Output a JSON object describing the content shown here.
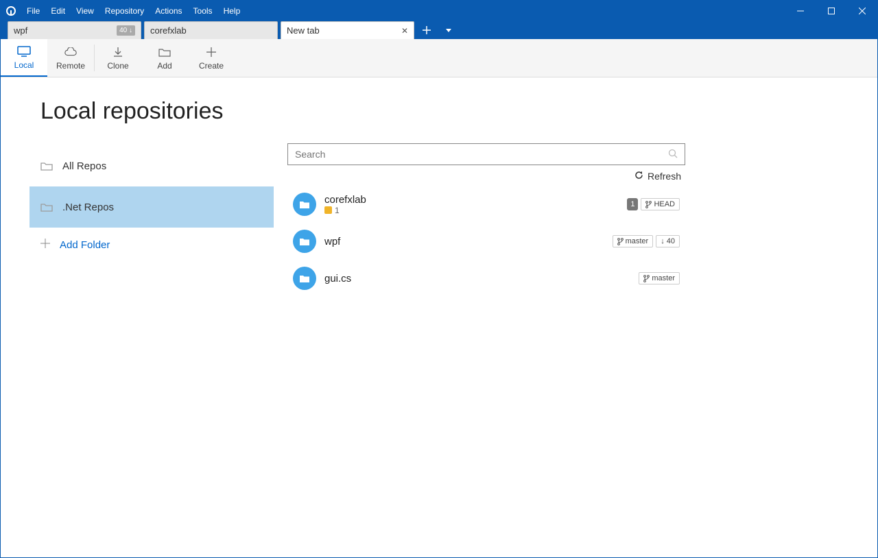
{
  "menu": {
    "file": "File",
    "edit": "Edit",
    "view": "View",
    "repository": "Repository",
    "actions": "Actions",
    "tools": "Tools",
    "help": "Help"
  },
  "tabs": {
    "items": [
      {
        "label": "wpf",
        "badge": "40 ↓"
      },
      {
        "label": "corefxlab"
      },
      {
        "label": "New tab",
        "closable": true,
        "active": true
      }
    ]
  },
  "toolbar": {
    "local": "Local",
    "remote": "Remote",
    "clone": "Clone",
    "add": "Add",
    "create": "Create"
  },
  "page": {
    "title": "Local repositories",
    "folders": [
      {
        "label": "All Repos"
      },
      {
        "label": ".Net Repos",
        "selected": true
      }
    ],
    "add_folder": "Add Folder",
    "search_placeholder": "Search",
    "refresh": "Refresh"
  },
  "repos": [
    {
      "name": "corefxlab",
      "stash": "1",
      "countbadge": "1",
      "branch": "HEAD"
    },
    {
      "name": "wpf",
      "branch": "master",
      "behind": "↓ 40"
    },
    {
      "name": "gui.cs",
      "branch": "master"
    }
  ]
}
